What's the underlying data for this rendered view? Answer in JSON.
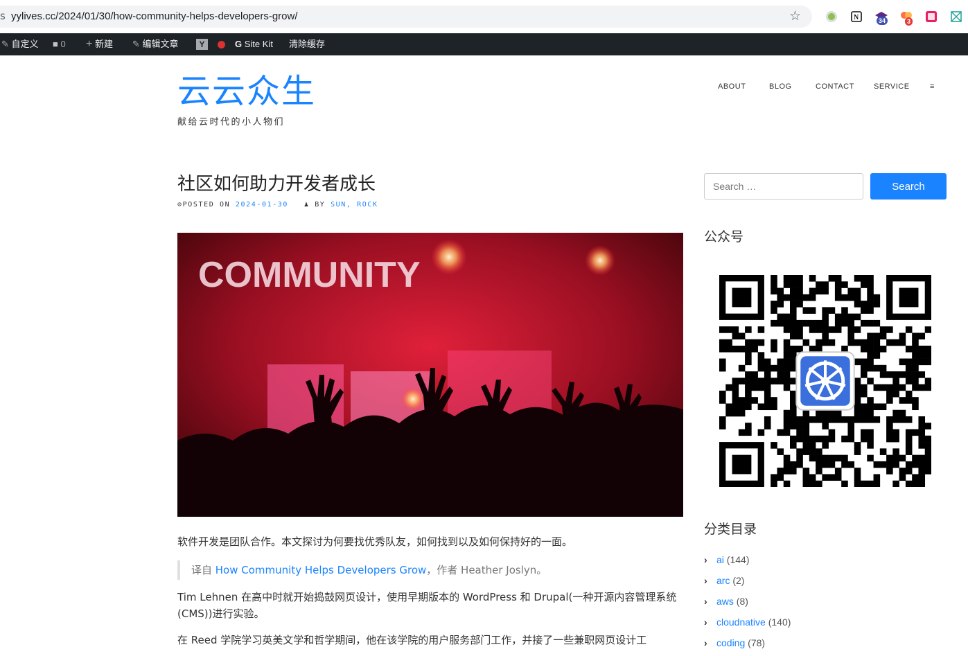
{
  "browser": {
    "url_lead": "s",
    "url": "yylives.cc/2024/01/30/how-community-helps-developers-grow/",
    "ext_badges": [
      "34",
      "3"
    ]
  },
  "adminbar": {
    "customize": "自定义",
    "comments_count": "0",
    "new": "新建",
    "edit": "编辑文章",
    "sitekit": "Site Kit",
    "clear_cache": "清除缓存"
  },
  "header": {
    "site_title": "云云众生",
    "site_desc": "献给云时代的小人物们",
    "nav": [
      "ABOUT",
      "BLOG",
      "CONTACT",
      "SERVICE",
      "≡"
    ]
  },
  "post": {
    "title": "社区如何助力开发者成长",
    "posted_on": "POSTED ON",
    "date": "2024-01-30",
    "by": "BY",
    "author": "SUN, ROCK",
    "hero_text": "COMMUNITY",
    "intro": "软件开发是团队合作。本文探讨为何要找优秀队友，如何找到以及如何保持好的一面。",
    "quote_prefix": "译自 ",
    "quote_link": "How Community Helps Developers Grow",
    "quote_suffix": "，作者 Heather Joslyn。",
    "para2": "Tim Lehnen 在高中时就开始捣鼓网页设计，使用早期版本的 WordPress 和 Drupal(一种开源内容管理系统(CMS))进行实验。",
    "para3": "在 Reed 学院学习英美文学和哲学期间，他在该学院的用户服务部门工作，并接了一些兼职网页设计工"
  },
  "sidebar": {
    "search_placeholder": "Search …",
    "search_button": "Search",
    "wechat_title": "公众号",
    "categories_title": "分类目录",
    "categories": [
      {
        "name": "ai",
        "count": "(144)"
      },
      {
        "name": "arc",
        "count": "(2)"
      },
      {
        "name": "aws",
        "count": "(8)"
      },
      {
        "name": "cloudnative",
        "count": "(140)"
      },
      {
        "name": "coding",
        "count": "(78)"
      }
    ]
  },
  "colors": {
    "accent": "#1a83ff",
    "adminbar_bg": "#1d2327"
  }
}
